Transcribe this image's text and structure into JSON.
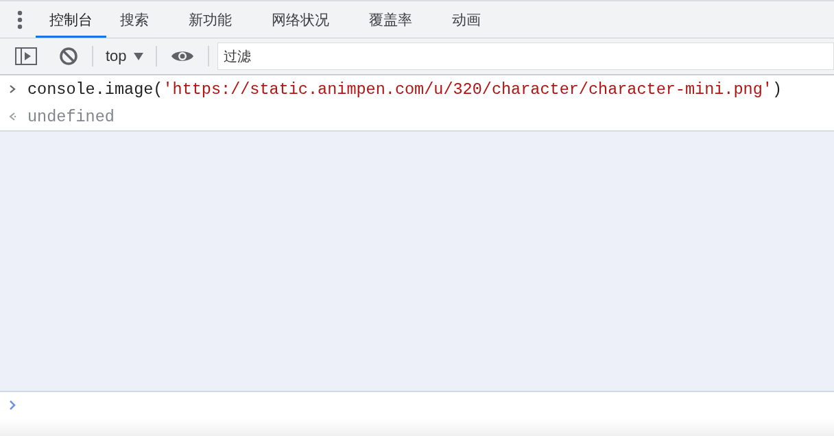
{
  "tabs": [
    {
      "label": "控制台",
      "selected": true
    },
    {
      "label": "搜索",
      "selected": false
    },
    {
      "label": "新功能",
      "selected": false
    },
    {
      "label": "网络状况",
      "selected": false
    },
    {
      "label": "覆盖率",
      "selected": false
    },
    {
      "label": "动画",
      "selected": false
    }
  ],
  "toolbar": {
    "context": "top",
    "filter": {
      "placeholder": "过滤"
    }
  },
  "console": [
    {
      "kind": "input",
      "call": "console.image(",
      "argument": "'https://static.animpen.com/u/320/character/character-mini.png'",
      "close": ")"
    },
    {
      "kind": "result",
      "value": "undefined"
    }
  ]
}
